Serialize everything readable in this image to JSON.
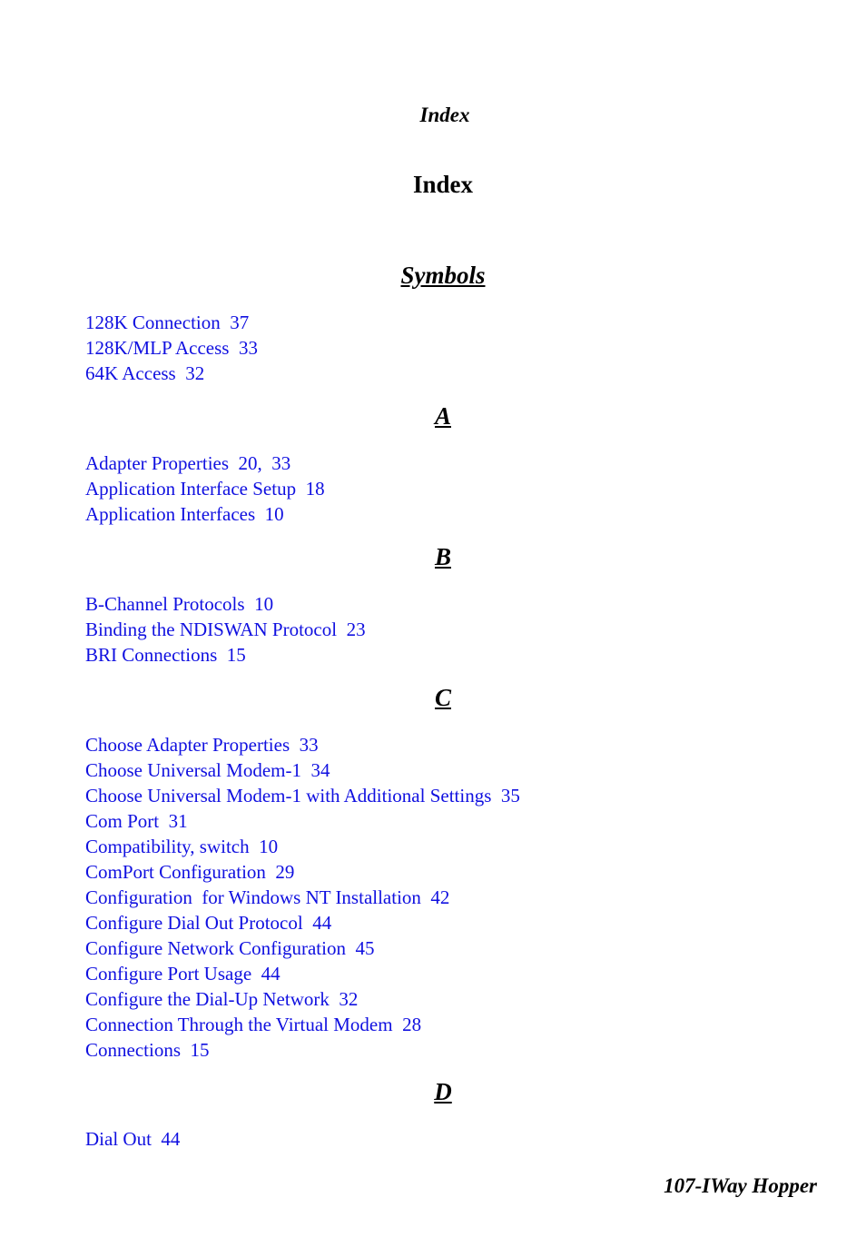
{
  "running_head": "Index",
  "title": "Index",
  "sections": [
    {
      "heading": "Symbols",
      "entries": [
        "128K Connection  37",
        "128K/MLP Access  33",
        "64K Access  32"
      ]
    },
    {
      "heading": "A",
      "entries": [
        "Adapter Properties  20,  33",
        "Application Interface Setup  18",
        "Application Interfaces  10"
      ]
    },
    {
      "heading": "B",
      "entries": [
        "B-Channel Protocols  10",
        "Binding the NDISWAN Protocol  23",
        "BRI Connections  15"
      ]
    },
    {
      "heading": "C",
      "entries": [
        "Choose Adapter Properties  33",
        "Choose Universal Modem-1  34",
        "Choose Universal Modem-1 with Additional Settings  35",
        "Com Port  31",
        "Compatibility, switch  10",
        "ComPort Configuration  29",
        "Configuration  for Windows NT Installation  42",
        "Configure Dial Out Protocol  44",
        "Configure Network Configuration  45",
        "Configure Port Usage  44",
        "Configure the Dial-Up Network  32",
        "Connection Through the Virtual Modem  28",
        "Connections  15"
      ]
    },
    {
      "heading": "D",
      "entries": [
        "Dial Out  44"
      ]
    }
  ],
  "footer": "107-IWay Hopper"
}
